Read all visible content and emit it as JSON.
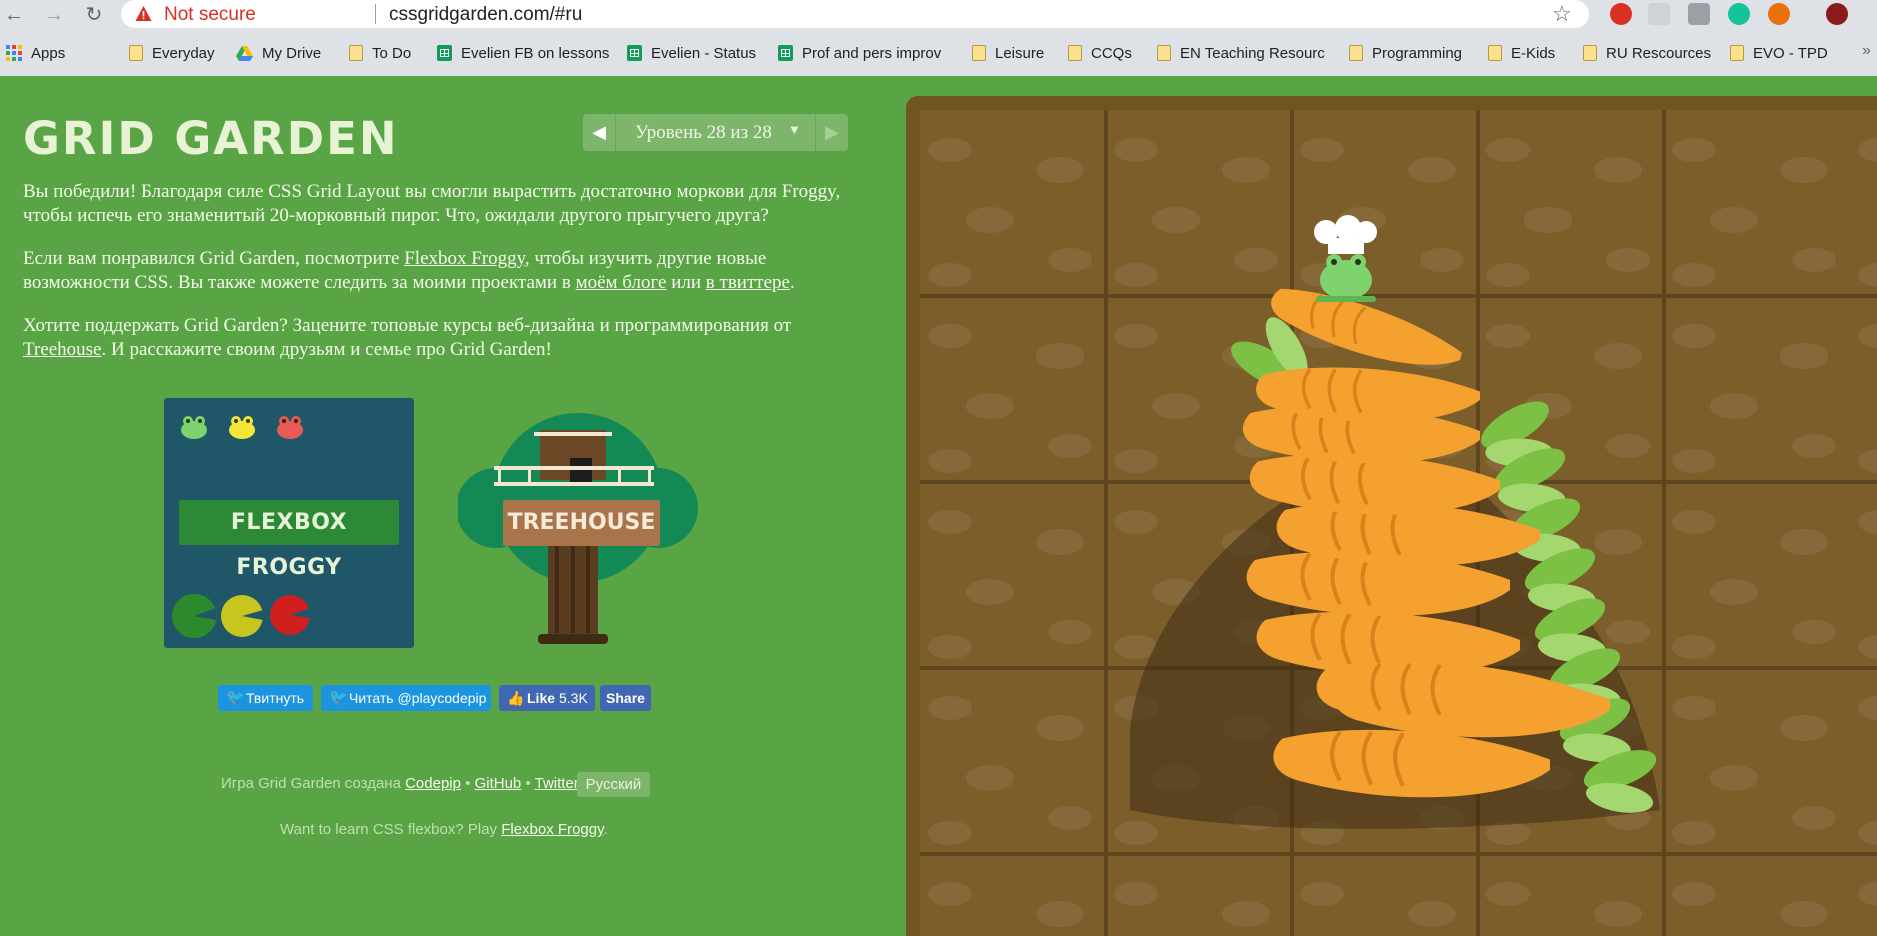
{
  "browser": {
    "nav": {
      "back": "←",
      "forward": "→",
      "reload": "↻"
    },
    "security_label": "Not secure",
    "url": "cssgridgarden.com/#ru",
    "star": "☆",
    "bookmarks": [
      {
        "label": "Apps",
        "icon": "apps-grid-icon"
      },
      {
        "label": "Everyday",
        "icon": "folder-icon"
      },
      {
        "label": "My Drive",
        "icon": "drive-icon"
      },
      {
        "label": "To Do",
        "icon": "folder-icon"
      },
      {
        "label": "Evelien FB on lessons",
        "icon": "sheets-icon"
      },
      {
        "label": "Evelien - Status",
        "icon": "sheets-icon"
      },
      {
        "label": "Prof and pers improv",
        "icon": "sheets-icon"
      },
      {
        "label": "Leisure",
        "icon": "folder-icon"
      },
      {
        "label": "CCQs",
        "icon": "folder-icon"
      },
      {
        "label": "EN Teaching Resourc",
        "icon": "folder-icon"
      },
      {
        "label": "Programming",
        "icon": "folder-icon"
      },
      {
        "label": "E-Kids",
        "icon": "folder-icon"
      },
      {
        "label": "RU Rescources",
        "icon": "folder-icon"
      },
      {
        "label": "EVO - TPD",
        "icon": "folder-icon"
      }
    ],
    "bookmarks_more": "»"
  },
  "page": {
    "title": "GRID GARDEN",
    "level": {
      "label": "Уровень 28 из 28",
      "prev": "◀",
      "next": "▶",
      "caret": "▼"
    },
    "p1": "Вы победили! Благодаря силе CSS Grid Layout вы смогли вырастить достаточно моркови для Froggy, чтобы испечь его знаменитый 20-морковный пирог. Что, ожидали другого прыгучего друга?",
    "p2": {
      "t1": "Если вам понравился Grid Garden, посмотрите ",
      "link1": "Flexbox Froggy",
      "t2": ", чтобы изучить другие новые возможности CSS. Вы также можете следить за моими проектами в ",
      "link2": "моём блоге",
      "t3": " или ",
      "link3": "в твиттере",
      "t4": "."
    },
    "p3": {
      "t1": "Хотите поддержать Grid Garden? Зацените топовые курсы веб-дизайна и программирования от ",
      "link1": "Treehouse",
      "t2": ". И расскажите своим друзьям и семье про Grid Garden!"
    },
    "promo": {
      "froggy": "FLEXBOX FROGGY",
      "treehouse": "TREEHOUSE"
    },
    "social": {
      "tweet": "Твитнуть",
      "follow": "Читать @playcodepip",
      "like": "Like",
      "like_count": "5.3K",
      "share": "Share"
    },
    "footer": {
      "made_by": "Игра Grid Garden создана",
      "codepip": "Codepip",
      "github": "GitHub",
      "twitter": "Twitter",
      "dot": "•",
      "language": "Русский",
      "flexbox_prompt": "Want to learn CSS flexbox? Play",
      "flexbox_link": "Flexbox Froggy",
      "period": "."
    }
  },
  "colors": {
    "background": "#59a445",
    "soil": "#7c5e2a",
    "carrot": "#f5a12f",
    "leaf": "#7cc144"
  }
}
